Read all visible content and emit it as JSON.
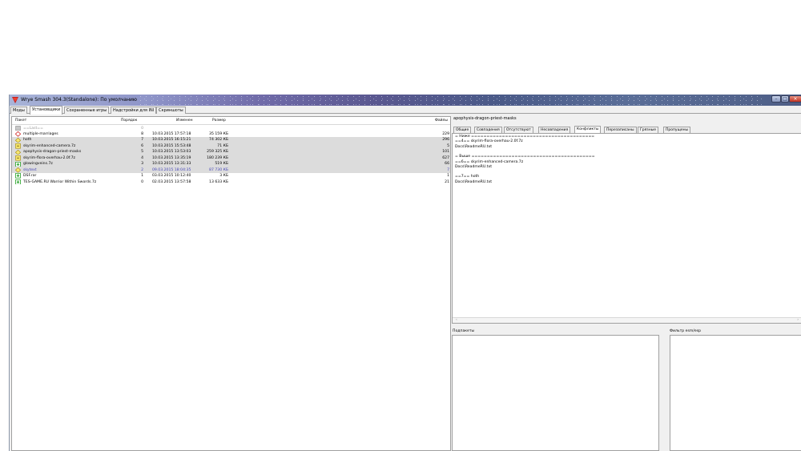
{
  "window": {
    "title": "Wrye Smash 304.3(Standalone): По умолчанию"
  },
  "main_tabs": [
    {
      "label": "Моды"
    },
    {
      "label": "Установщики"
    },
    {
      "label": "Сохраненные игры"
    },
    {
      "label": "Надстройки для INI"
    },
    {
      "label": "Скриншоты"
    }
  ],
  "active_tab": "Установщики",
  "table": {
    "columns": {
      "package": "Пакет",
      "order": "Порядок",
      "modified": "Изменен",
      "size": "Размер",
      "files": "Файлы"
    },
    "rows": [
      {
        "name": "==Last==",
        "order": "0",
        "date": "",
        "size": "",
        "files": "",
        "icon": "marker-icon",
        "grey": false,
        "style": "muted"
      },
      {
        "name": "multiple-marriages",
        "order": "8",
        "date": "10.03.2015 17:57:18",
        "size": "35 159 КБ",
        "files": "229",
        "icon": "diamond-red-icon",
        "grey": false,
        "style": ""
      },
      {
        "name": "hoth",
        "order": "7",
        "date": "10.03.2015 16:15:21",
        "size": "74 302 КБ",
        "files": "296",
        "icon": "diamond-yellow-icon",
        "grey": true,
        "style": ""
      },
      {
        "name": "skyrim-enhanced-camera.7z",
        "order": "6",
        "date": "10.03.2015 15:53:48",
        "size": "71 КБ",
        "files": "5",
        "icon": "square-yellow-icon",
        "grey": true,
        "style": ""
      },
      {
        "name": "apophysis-dragon-priest-masks",
        "order": "5",
        "date": "10.03.2015 13:53:03",
        "size": "259 325 КБ",
        "files": "101",
        "icon": "diamond-yellow-icon",
        "grey": true,
        "style": ""
      },
      {
        "name": "skyrim-flora-overhau-2.0f.7z",
        "order": "4",
        "date": "10.03.2015 13:35:19",
        "size": "180 239 КБ",
        "files": "627",
        "icon": "square-yellow-icon",
        "grey": true,
        "style": ""
      },
      {
        "name": "glowingveins.7z",
        "order": "3",
        "date": "10.03.2015 13:31:33",
        "size": "519 КБ",
        "files": "66",
        "icon": "square-green-icon",
        "grey": true,
        "style": ""
      },
      {
        "name": "skytext",
        "order": "2",
        "date": "09.03.2015 18:04:35",
        "size": "87 730 КБ",
        "files": "7",
        "icon": "diamond-yellow-icon",
        "grey": true,
        "style": "blue"
      },
      {
        "name": "DSF.rar",
        "order": "1",
        "date": "03.03.2015 10:12:40",
        "size": "3 КБ",
        "files": "1",
        "icon": "square-green-icon",
        "grey": false,
        "style": ""
      },
      {
        "name": "TES-GAME.RU Warrior Within Swords.7z",
        "order": "0",
        "date": "02.03.2015 13:57:58",
        "size": "13 633 КБ",
        "files": "21",
        "icon": "square-green-icon",
        "grey": false,
        "style": ""
      }
    ]
  },
  "details": {
    "selected_package": "apophysis-dragon-priest-masks",
    "tabs": [
      {
        "label": "Общие"
      },
      {
        "label": "Совпадения"
      },
      {
        "label": "Отсутствуют"
      },
      {
        "label": "Несовпадения"
      },
      {
        "label": "Конфликты"
      },
      {
        "label": "Перезаписаны"
      },
      {
        "label": "Грязные"
      },
      {
        "label": "Пропущены"
      }
    ],
    "active_tab": "Конфликты",
    "conflict_lines": [
      "= Ниже ========================================",
      "==4== skyrim-flora-overhau-2.0f.7z",
      "Docs\\ReadmeRU.txt",
      "",
      "= Выше ========================================",
      "==6== skyrim-enhanced-camera.7z",
      "Docs\\ReadmeRU.txt",
      "",
      "==7== hoth",
      "Docs\\ReadmeRU.txt"
    ],
    "subpackages_label": "Подпакеты",
    "esm_filter_label": "Фильтр esm/esp"
  },
  "colors": {
    "grey_row": "#dcdcdc",
    "blue_text": "#4848b8",
    "panel_border": "#a0a0a0"
  }
}
